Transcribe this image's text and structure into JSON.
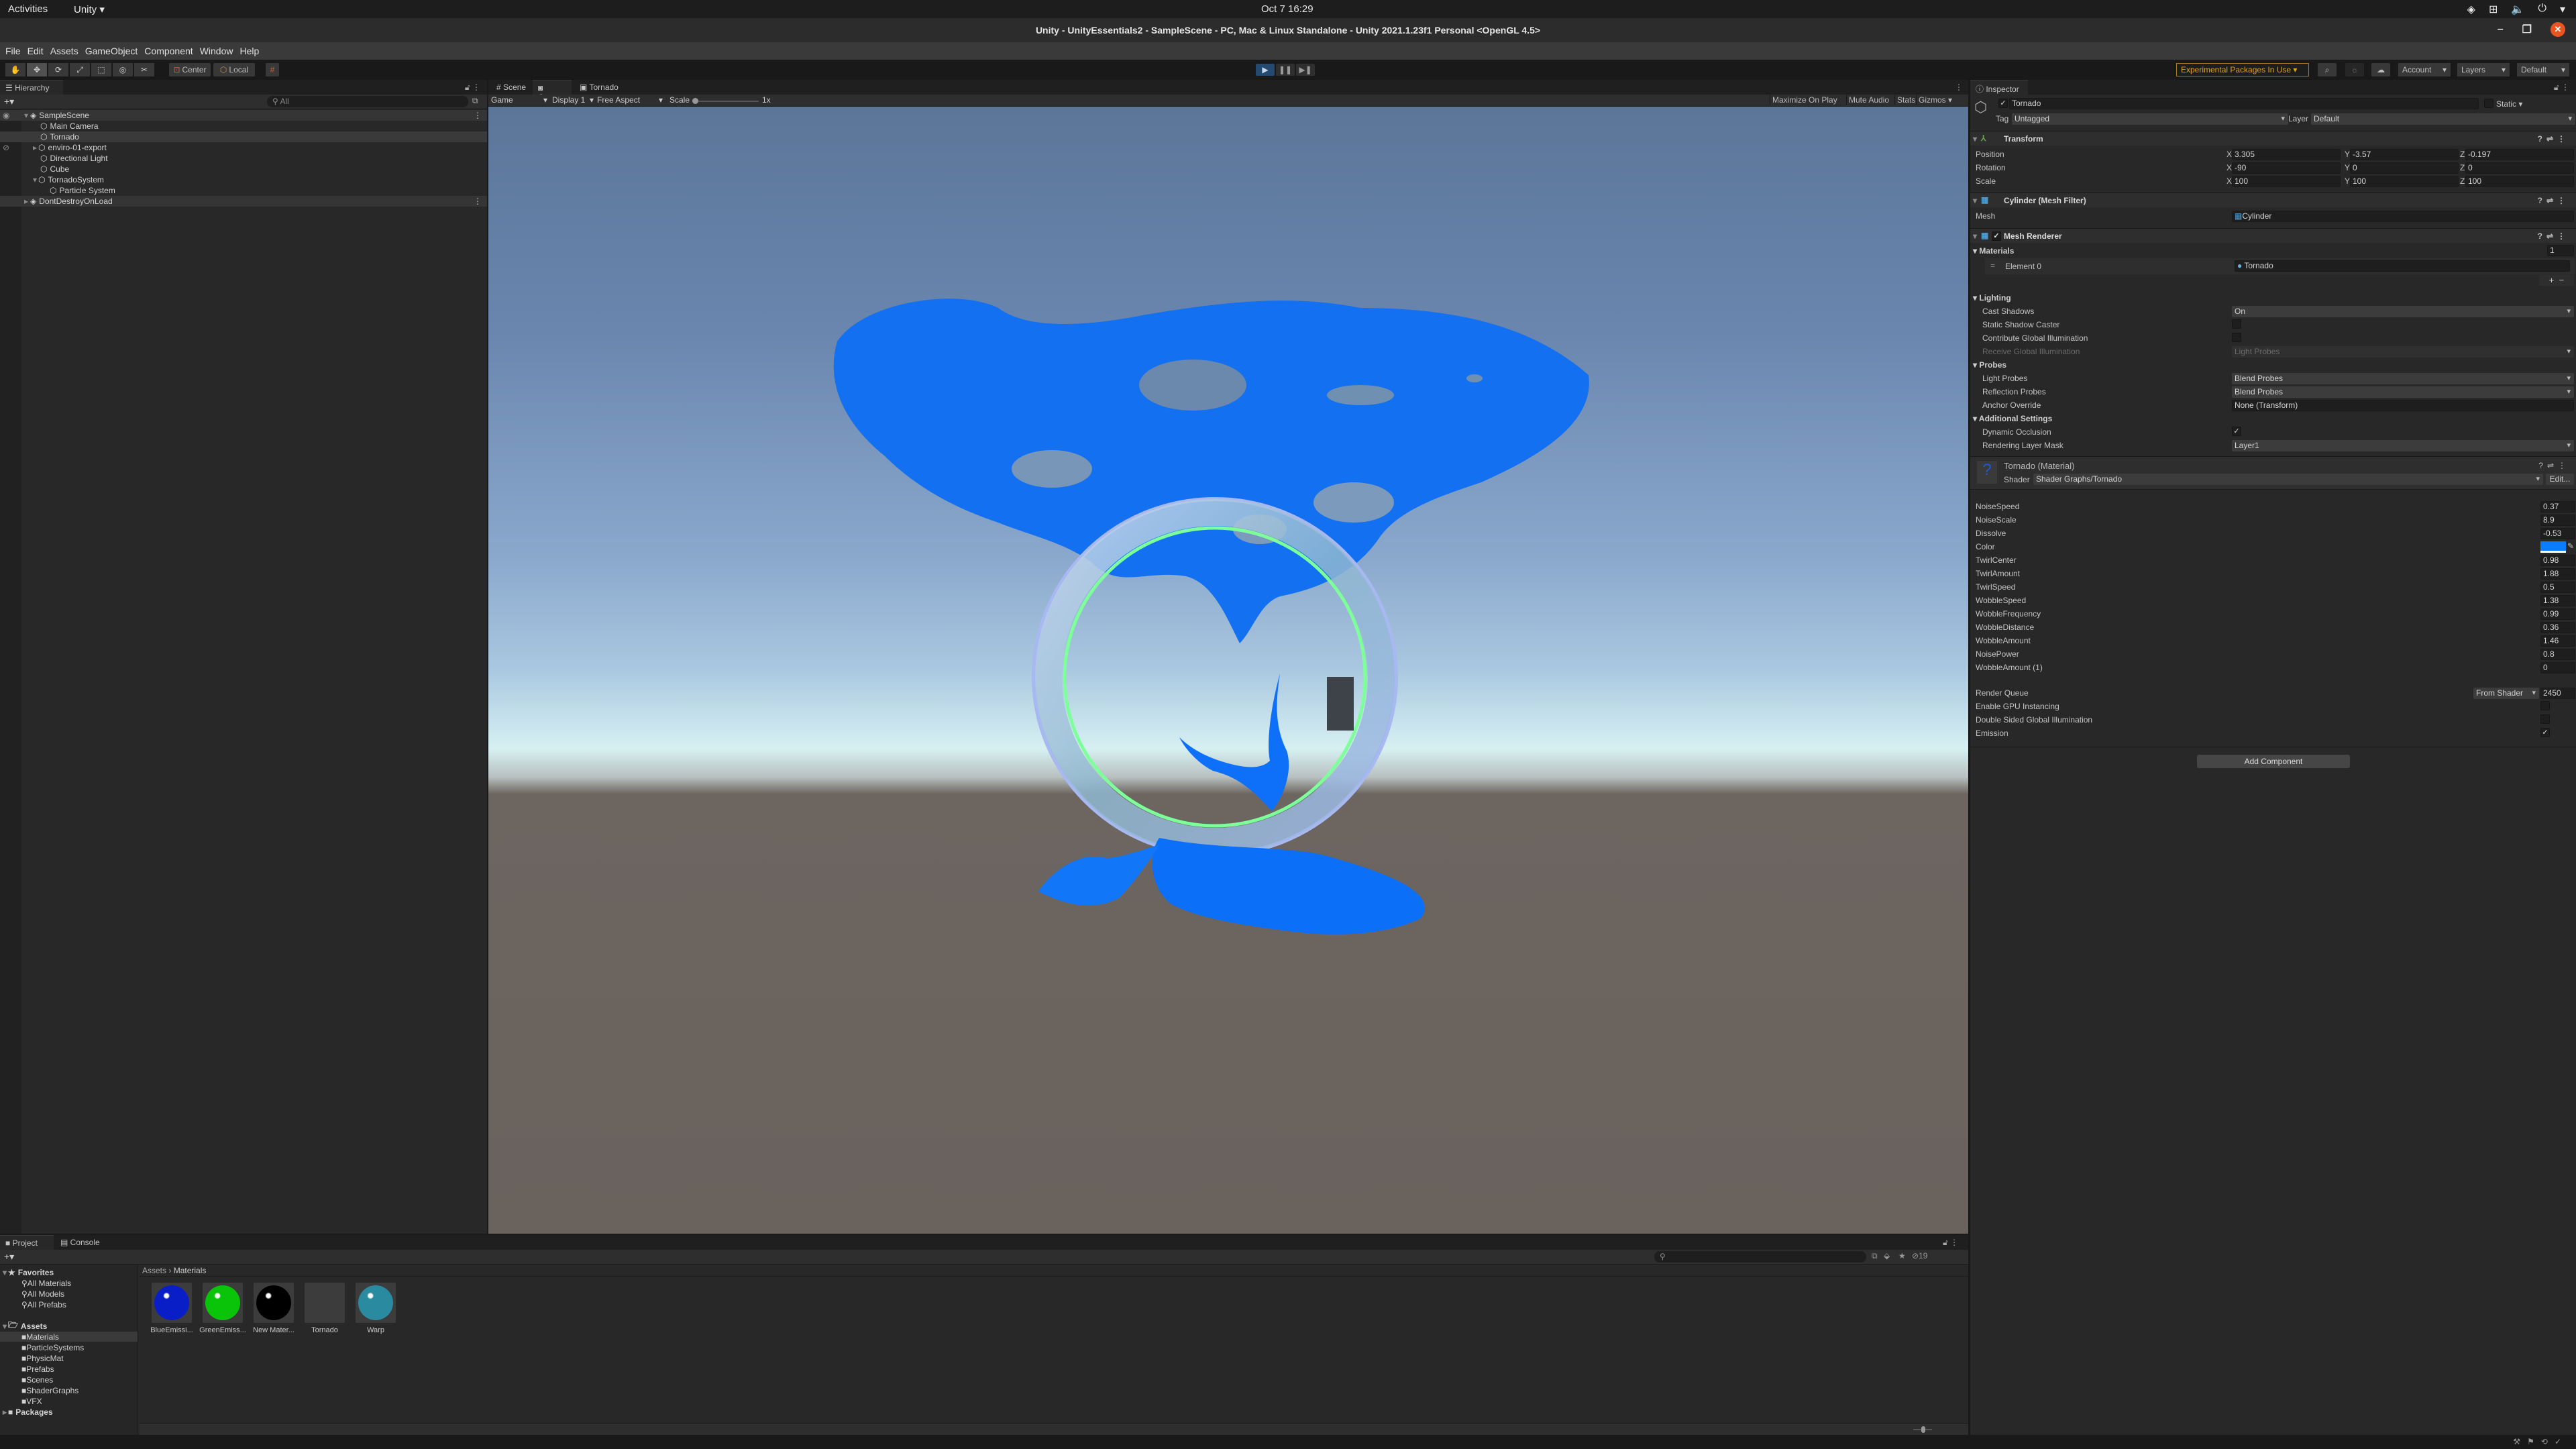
{
  "system": {
    "activities": "Activities",
    "app_menu": "Unity ▾",
    "clock": "Oct 7  16:29",
    "tray_icons": [
      "unity-icon",
      "network-icon",
      "volume-icon",
      "power-icon",
      "chevron-down-icon"
    ]
  },
  "window": {
    "title": "Unity - UnityEssentials2 - SampleScene - PC, Mac & Linux Standalone - Unity 2021.1.23f1 Personal <OpenGL 4.5>",
    "minimize": "–",
    "maximize": "❐",
    "close": "✕"
  },
  "menu": [
    "File",
    "Edit",
    "Assets",
    "GameObject",
    "Component",
    "Window",
    "Help"
  ],
  "toolbar": {
    "tools": [
      "✋",
      "✥",
      "⟳",
      "⤢",
      "⬚",
      "◎",
      "✂"
    ],
    "pivot": "Center",
    "space": "Local",
    "snap": "#",
    "play": "▶",
    "pause": "❚❚",
    "step": "▶❚",
    "experimental": "Experimental Packages In Use ▾",
    "search": "⌕",
    "collab": "☼",
    "cloud": "☁",
    "account": "Account",
    "layers": "Layers",
    "layout": "Default"
  },
  "hierarchy": {
    "tab": "Hierarchy",
    "add": "+▾",
    "search_placeholder": "All",
    "items": [
      {
        "label": "SampleScene",
        "depth": 0,
        "type": "scene",
        "expanded": true
      },
      {
        "label": "Main Camera",
        "depth": 1
      },
      {
        "label": "Tornado",
        "depth": 1,
        "selected": true
      },
      {
        "label": "enviro-01-export",
        "depth": 1,
        "collapsed": true,
        "hidden": true
      },
      {
        "label": "Directional Light",
        "depth": 1
      },
      {
        "label": "Cube",
        "depth": 1
      },
      {
        "label": "TornadoSystem",
        "depth": 1,
        "expanded": true
      },
      {
        "label": "Particle System",
        "depth": 2
      },
      {
        "label": "DontDestroyOnLoad",
        "depth": 0,
        "type": "scene",
        "collapsed": true
      }
    ]
  },
  "game": {
    "tabs": [
      "Scene",
      "Game",
      "Tornado"
    ],
    "active_tab": "Game",
    "mode": "Game",
    "display": "Display 1",
    "aspect": "Free Aspect",
    "scale_label": "Scale",
    "scale_value": "1x",
    "maximize": "Maximize On Play",
    "mute": "Mute Audio",
    "stats": "Stats",
    "gizmos": "Gizmos"
  },
  "inspector": {
    "tab": "Inspector",
    "object_name": "Tornado",
    "active": true,
    "static": "Static",
    "tag_label": "Tag",
    "tag": "Untagged",
    "layer_label": "Layer",
    "layer": "Default",
    "transform": {
      "title": "Transform",
      "position": {
        "label": "Position",
        "x": "3.305",
        "y": "-3.57",
        "z": "-0.197"
      },
      "rotation": {
        "label": "Rotation",
        "x": "-90",
        "y": "0",
        "z": "0"
      },
      "scale": {
        "label": "Scale",
        "x": "100",
        "y": "100",
        "z": "100"
      }
    },
    "mesh_filter": {
      "title": "Cylinder (Mesh Filter)",
      "mesh_label": "Mesh",
      "mesh": "Cylinder"
    },
    "mesh_renderer": {
      "title": "Mesh Renderer",
      "materials_label": "Materials",
      "materials_count": "1",
      "element0_label": "Element 0",
      "element0": "Tornado",
      "lighting": "Lighting",
      "cast_shadows_label": "Cast Shadows",
      "cast_shadows": "On",
      "static_shadow_label": "Static Shadow Caster",
      "contribute_gi_label": "Contribute Global Illumination",
      "receive_gi_label": "Receive Global Illumination",
      "receive_gi": "Light Probes",
      "probes": "Probes",
      "light_probes_label": "Light Probes",
      "light_probes": "Blend Probes",
      "reflection_probes_label": "Reflection Probes",
      "reflection_probes": "Blend Probes",
      "anchor_label": "Anchor Override",
      "anchor": "None (Transform)",
      "additional": "Additional Settings",
      "dynamic_occlusion_label": "Dynamic Occlusion",
      "dynamic_occlusion": true,
      "rendering_layer_label": "Rendering Layer Mask",
      "rendering_layer": "Layer1"
    },
    "material": {
      "title": "Tornado (Material)",
      "shader_label": "Shader",
      "shader": "Shader Graphs/Tornado",
      "edit": "Edit...",
      "props": [
        {
          "label": "NoiseSpeed",
          "value": "0.37"
        },
        {
          "label": "NoiseScale",
          "value": "8.9"
        },
        {
          "label": "Dissolve",
          "value": "-0.53"
        },
        {
          "label": "Color",
          "value": "",
          "color": "#0a7cff"
        },
        {
          "label": "TwirlCenter",
          "value": "0.98"
        },
        {
          "label": "TwirlAmount",
          "value": "1.88"
        },
        {
          "label": "TwirlSpeed",
          "value": "0.5"
        },
        {
          "label": "WobbleSpeed",
          "value": "1.38"
        },
        {
          "label": "WobbleFrequency",
          "value": "0.99"
        },
        {
          "label": "WobbleDistance",
          "value": "0.36"
        },
        {
          "label": "WobbleAmount",
          "value": "1.46"
        },
        {
          "label": "NoisePower",
          "value": "0.8"
        },
        {
          "label": "WobbleAmount (1)",
          "value": "0"
        }
      ],
      "render_queue_label": "Render Queue",
      "render_queue_mode": "From Shader",
      "render_queue": "2450",
      "gpu_instancing_label": "Enable GPU Instancing",
      "double_sided_gi_label": "Double Sided Global Illumination",
      "emission_label": "Emission",
      "emission": true
    },
    "add_component": "Add Component"
  },
  "project": {
    "tabs": [
      "Project",
      "Console"
    ],
    "add": "+▾",
    "breadcrumb": [
      "Assets",
      "Materials"
    ],
    "hidden_count": "19",
    "favorites": {
      "label": "Favorites",
      "items": [
        "All Materials",
        "All Models",
        "All Prefabs"
      ]
    },
    "assets": {
      "label": "Assets",
      "items": [
        "Materials",
        "ParticleSystems",
        "PhysicMat",
        "Prefabs",
        "Scenes",
        "ShaderGraphs",
        "VFX"
      ],
      "selected": "Materials"
    },
    "packages": "Packages",
    "files": [
      {
        "label": "BlueEmissi...",
        "color": "#0a1ec8"
      },
      {
        "label": "GreenEmiss...",
        "color": "#0ac40a"
      },
      {
        "label": "New Mater...",
        "color": "#000000"
      },
      {
        "label": "Tornado",
        "color": ""
      },
      {
        "label": "Warp",
        "color": "#2a8aa0"
      }
    ]
  },
  "colors": {
    "accent_blue": "#234a70",
    "experimental": "#e0a41c",
    "tornado_blue": "#0a6cff",
    "ring_green": "#7dff9a"
  }
}
